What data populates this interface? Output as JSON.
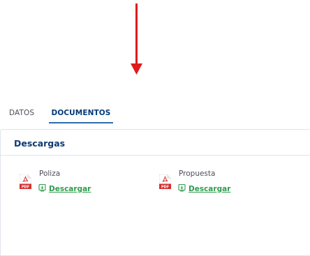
{
  "annotation": {
    "arrow_color": "#e01b1b",
    "arrow_direction": "down"
  },
  "tabs": [
    {
      "label": "DATOS",
      "active": false
    },
    {
      "label": "DOCUMENTOS",
      "active": true
    }
  ],
  "section": {
    "title": "Descargas"
  },
  "documents": [
    {
      "name": "Poliza",
      "link": "Descargar",
      "icon": "pdf-file-icon"
    },
    {
      "name": "Propuesta",
      "link": "Descargar",
      "icon": "pdf-file-icon"
    }
  ],
  "colors": {
    "tab_active_text": "#003a78",
    "tab_underline": "#2d6cb0",
    "section_title": "#0d3a74",
    "link": "#2e9c4c",
    "pdf_red": "#d32f2f"
  }
}
